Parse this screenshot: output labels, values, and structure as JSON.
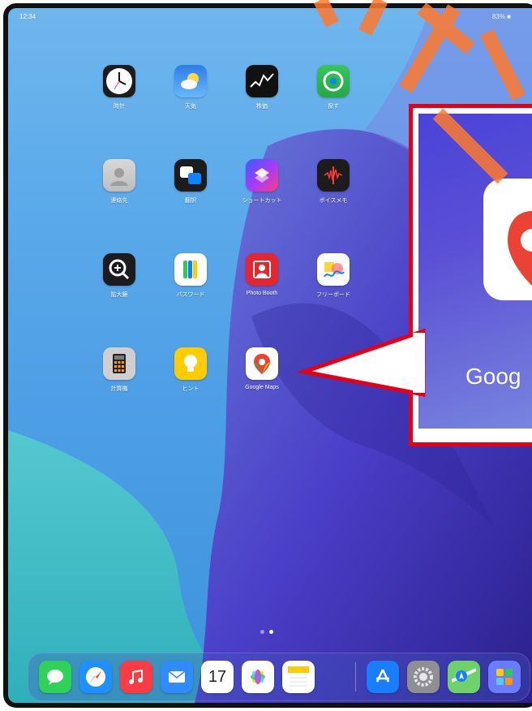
{
  "status": {
    "time": "12:34",
    "right": "83% ■"
  },
  "apps": [
    {
      "id": "clock",
      "label": "時計",
      "icon": "clock-icon"
    },
    {
      "id": "weather",
      "label": "天気",
      "icon": "weather-icon"
    },
    {
      "id": "stocks",
      "label": "株価",
      "icon": "stocks-icon"
    },
    {
      "id": "findmy",
      "label": "探す",
      "icon": "find-my-icon"
    },
    {
      "id": "contacts",
      "label": "連絡先",
      "icon": "contacts-icon"
    },
    {
      "id": "translate",
      "label": "翻訳",
      "icon": "translate-icon"
    },
    {
      "id": "shortcuts",
      "label": "ショートカット",
      "icon": "shortcuts-icon"
    },
    {
      "id": "voicememos",
      "label": "ボイスメモ",
      "icon": "voice-memo-icon"
    },
    {
      "id": "magnifier",
      "label": "拡大鏡",
      "icon": "magnifier-icon"
    },
    {
      "id": "passwords",
      "label": "パスワード",
      "icon": "passwords-icon"
    },
    {
      "id": "photobooth",
      "label": "Photo Booth",
      "icon": "photo-booth-icon"
    },
    {
      "id": "freeform",
      "label": "フリーボード",
      "icon": "freeform-icon"
    },
    {
      "id": "calculator",
      "label": "計算機",
      "icon": "calculator-icon"
    },
    {
      "id": "tips",
      "label": "ヒント",
      "icon": "tips-icon"
    },
    {
      "id": "googlemaps",
      "label": "Google Maps",
      "icon": "google-maps-icon"
    }
  ],
  "dock": [
    {
      "id": "messages",
      "icon": "messages-icon",
      "color": "#2fd158"
    },
    {
      "id": "safari",
      "icon": "safari-icon",
      "color": "#1e90ff"
    },
    {
      "id": "music",
      "icon": "music-icon",
      "color": "#fc3c44"
    },
    {
      "id": "mail",
      "icon": "mail-icon",
      "color": "#2f8cff"
    },
    {
      "id": "calendar",
      "icon": "calendar-icon",
      "color": "#ffffff",
      "text": "17"
    },
    {
      "id": "photos",
      "icon": "photos-icon",
      "color": "#ffffff"
    },
    {
      "id": "notes",
      "icon": "notes-icon",
      "color": "#ffffff"
    },
    {
      "id": "appstore",
      "icon": "app-store-icon",
      "color": "#1a7cff"
    },
    {
      "id": "settings",
      "icon": "settings-icon",
      "color": "#8e8e93"
    },
    {
      "id": "maps",
      "icon": "maps-icon",
      "color": "#6fd16a"
    },
    {
      "id": "applibrary",
      "icon": "app-library-icon",
      "color": "#6a7cff"
    }
  ],
  "callout": {
    "text": "Goog"
  },
  "page_indicator": {
    "pages": 2,
    "current": 2
  }
}
